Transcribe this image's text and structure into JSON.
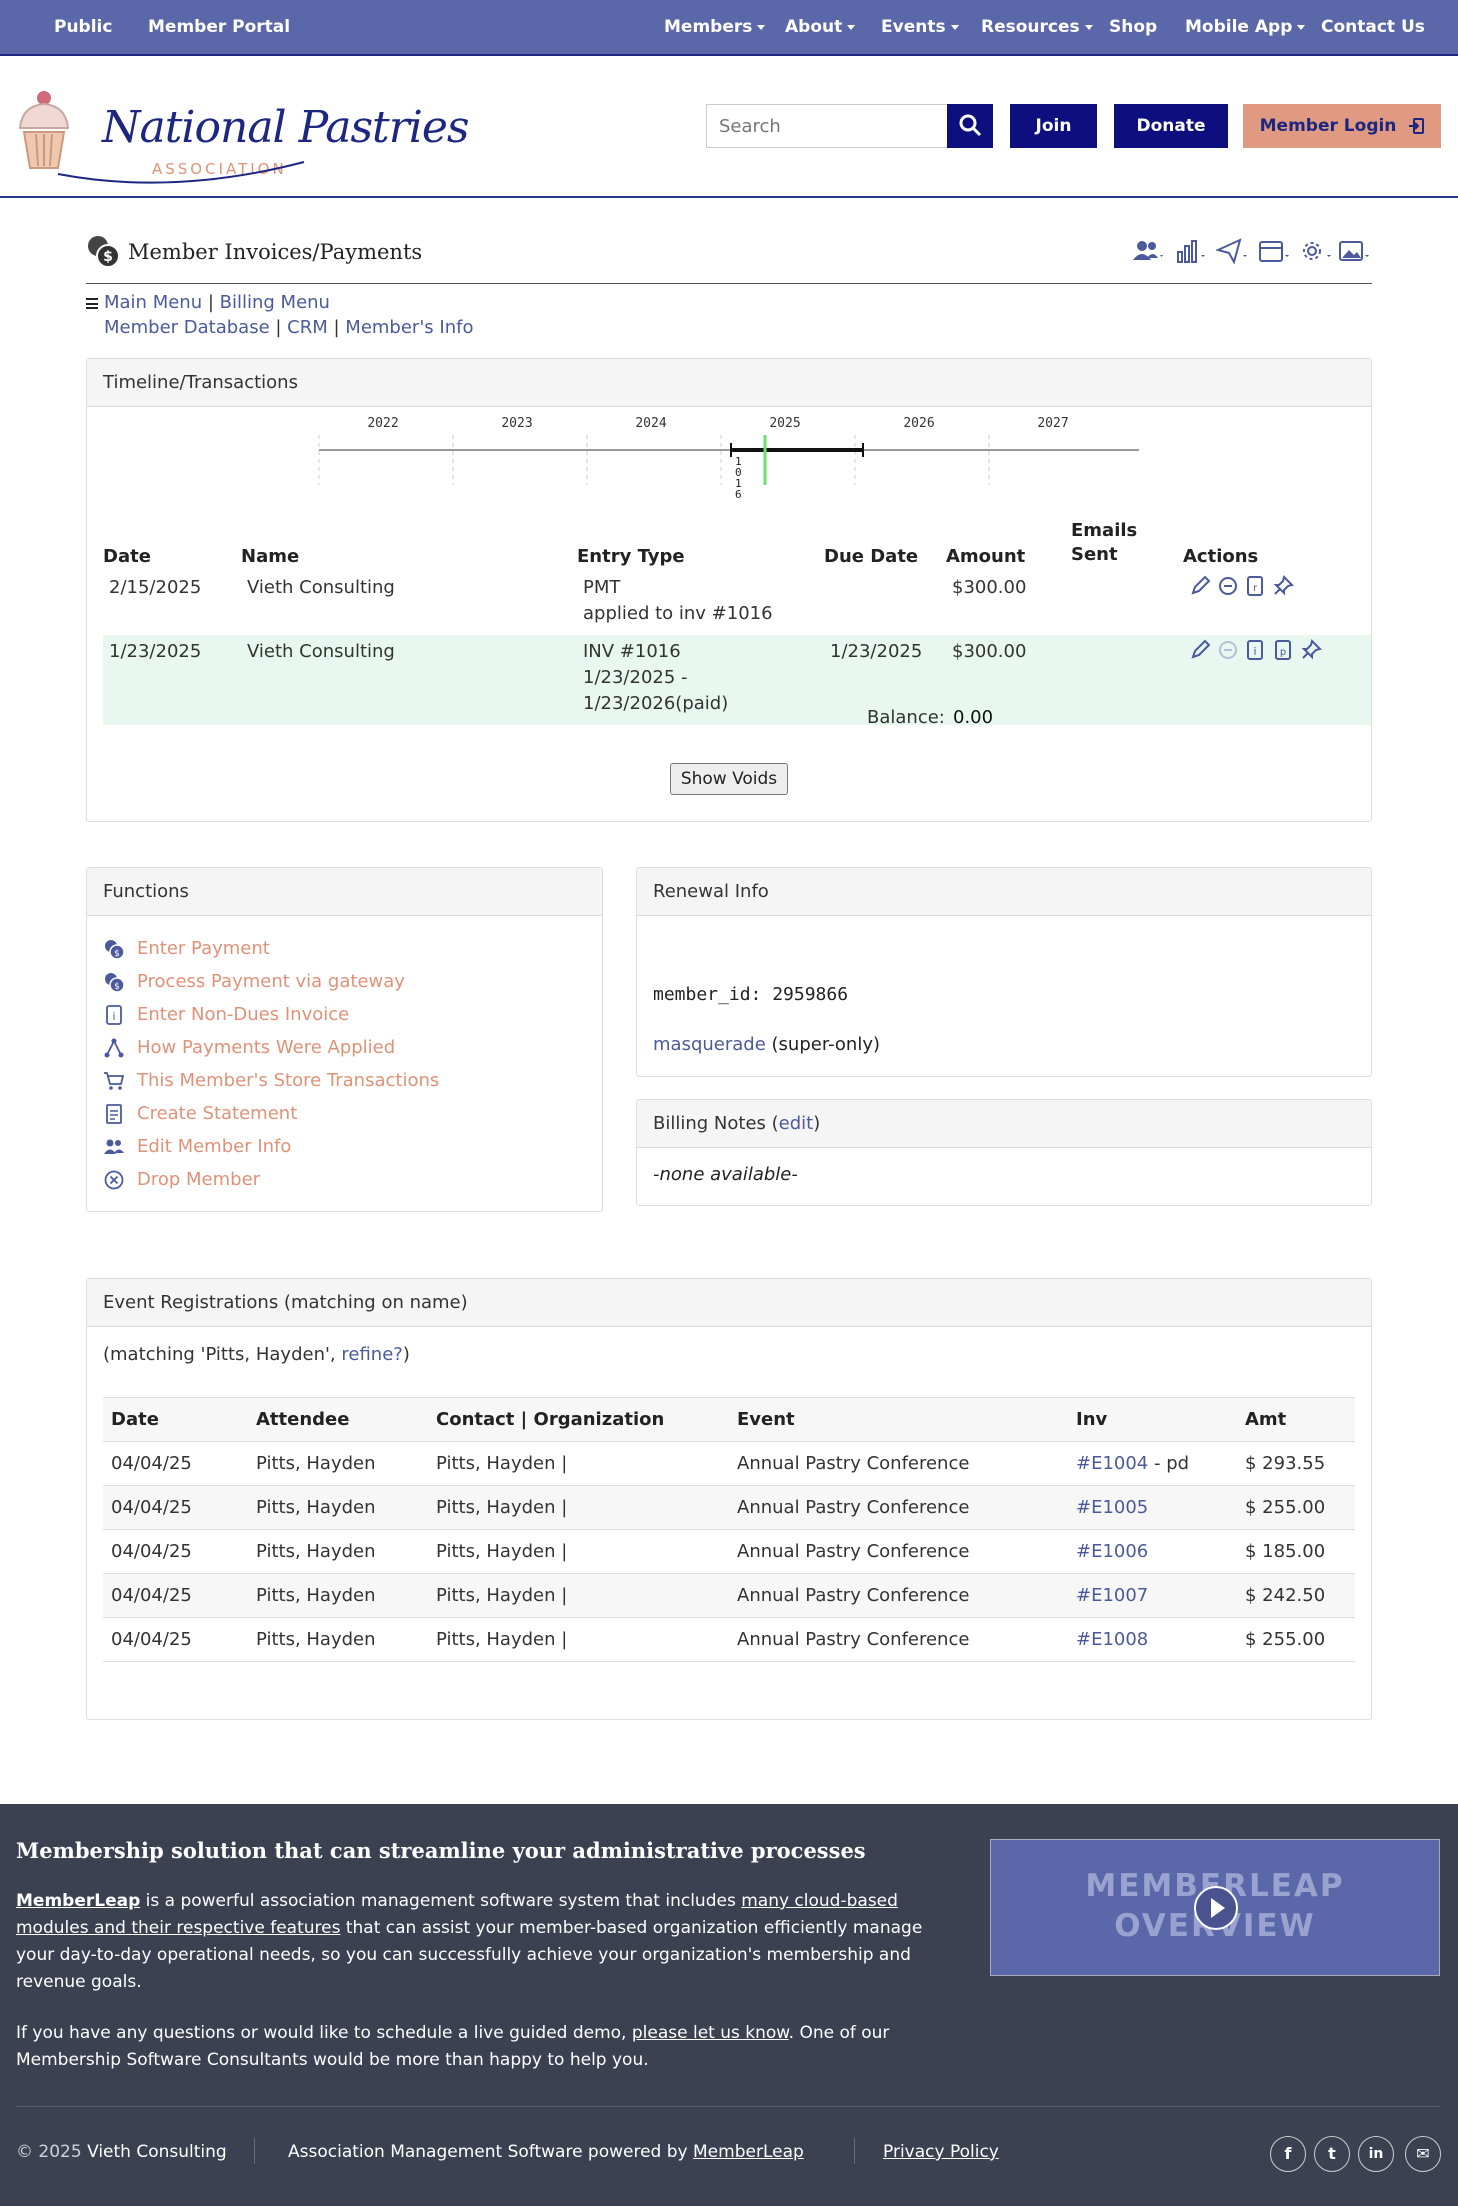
{
  "topnav": {
    "left": [
      "Public",
      "Member Portal"
    ],
    "right": [
      "Members",
      "About",
      "Events",
      "Resources",
      "Shop",
      "Mobile App",
      "Contact Us"
    ]
  },
  "header": {
    "logo_title": "National Pastries",
    "logo_subtitle": "ASSOCIATION",
    "search_placeholder": "Search",
    "join_label": "Join",
    "donate_label": "Donate",
    "login_label": "Member Login"
  },
  "page": {
    "title": "Member Invoices/Payments",
    "breadcrumb": {
      "main_menu": "Main Menu",
      "billing_menu": "Billing Menu",
      "member_database": "Member Database",
      "crm": "CRM",
      "members_info": "Member's Info"
    }
  },
  "timeline": {
    "heading": "Timeline/Transactions",
    "years": [
      "2022",
      "2023",
      "2024",
      "2025",
      "2026",
      "2027"
    ],
    "marker_label": [
      "1",
      "0",
      "1",
      "6"
    ],
    "columns": [
      "Date",
      "Name",
      "Entry Type",
      "Due Date",
      "Amount",
      "Emails Sent",
      "Actions"
    ],
    "rows": [
      {
        "date": "2/15/2025",
        "name": "Vieth Consulting",
        "entry": "PMT",
        "entry2": "applied to inv #1016",
        "entry3": "",
        "due": "",
        "amount": "$300.00"
      },
      {
        "date": "1/23/2025",
        "name": "Vieth Consulting",
        "entry": "INV #1016",
        "entry2": "1/23/2025 -",
        "entry3": "1/23/2026(paid)",
        "due": "1/23/2025",
        "amount": "$300.00"
      }
    ],
    "balance_label": "Balance:",
    "balance_value": "0.00",
    "show_voids": "Show Voids"
  },
  "functions": {
    "heading": "Functions",
    "items": [
      {
        "label": "Enter Payment",
        "icon": "coins-icon"
      },
      {
        "label": "Process Payment via gateway",
        "icon": "coins-icon"
      },
      {
        "label": "Enter Non-Dues Invoice",
        "icon": "invoice-icon"
      },
      {
        "label": "How Payments Were Applied",
        "icon": "share-icon"
      },
      {
        "label": "This Member's Store Transactions",
        "icon": "cart-icon"
      },
      {
        "label": "Create Statement",
        "icon": "statement-icon"
      },
      {
        "label": "Edit Member Info",
        "icon": "users-icon"
      },
      {
        "label": "Drop Member",
        "icon": "x-circle-icon"
      }
    ]
  },
  "renewal": {
    "heading": "Renewal Info",
    "member_id": "member_id: 2959866",
    "masquerade": "masquerade",
    "super_only": "(super-only)"
  },
  "billing_notes": {
    "heading_pre": "Billing Notes (",
    "edit": "edit",
    "heading_post": ")",
    "body": "-none available-"
  },
  "events": {
    "heading": "Event Registrations (matching on name)",
    "matching_pre": "(matching 'Pitts, Hayden', ",
    "refine": "refine?",
    "matching_post": ")",
    "columns": [
      "Date",
      "Attendee",
      "Contact | Organization",
      "Event",
      "Inv",
      "Amt"
    ],
    "rows": [
      {
        "date": "04/04/25",
        "attendee": "Pitts, Hayden",
        "contact": "Pitts, Hayden |",
        "event": "Annual Pastry Conference",
        "inv": "#E1004",
        "inv_suffix": " - pd",
        "amt": "$ 293.55"
      },
      {
        "date": "04/04/25",
        "attendee": "Pitts, Hayden",
        "contact": "Pitts, Hayden |",
        "event": "Annual Pastry Conference",
        "inv": "#E1005",
        "inv_suffix": "",
        "amt": "$ 255.00"
      },
      {
        "date": "04/04/25",
        "attendee": "Pitts, Hayden",
        "contact": "Pitts, Hayden |",
        "event": "Annual Pastry Conference",
        "inv": "#E1006",
        "inv_suffix": "",
        "amt": "$ 185.00"
      },
      {
        "date": "04/04/25",
        "attendee": "Pitts, Hayden",
        "contact": "Pitts, Hayden |",
        "event": "Annual Pastry Conference",
        "inv": "#E1007",
        "inv_suffix": "",
        "amt": "$ 242.50"
      },
      {
        "date": "04/04/25",
        "attendee": "Pitts, Hayden",
        "contact": "Pitts, Hayden |",
        "event": "Annual Pastry Conference",
        "inv": "#E1008",
        "inv_suffix": "",
        "amt": "$ 255.00"
      }
    ]
  },
  "footer": {
    "heading": "Membership solution that can streamline your administrative processes",
    "p1_brand": "MemberLeap",
    "p1_a": " is a powerful association management software system that includes ",
    "p1_link": "many cloud-based modules and their respective features",
    "p1_b": " that can assist your member-based organization efficiently manage your day-to-day operational needs, so you can successfully achieve your organization's membership and revenue goals.",
    "p2_a": "If you have any questions or would like to schedule a live guided demo, ",
    "p2_link": "please let us know",
    "p2_b": ". One of our Membership Software Consultants would be more than happy to help you.",
    "video_line1": "MEMBERLEAP",
    "video_line2": "OVERVIEW",
    "copyright": "© 2025",
    "company": "Vieth Consulting",
    "powered": "Association Management Software powered by ",
    "powered_link": "MemberLeap",
    "privacy": "Privacy Policy",
    "social": [
      "f",
      "t",
      "in",
      "✉"
    ]
  },
  "colors": {
    "nav": "#5a67a8",
    "dark_button": "#0d0f7e",
    "login_button": "#e09a82",
    "link": "#4a5a9c",
    "function_link": "#e09278",
    "paid_row": "#e8f8f0",
    "footer": "#3c4152"
  }
}
